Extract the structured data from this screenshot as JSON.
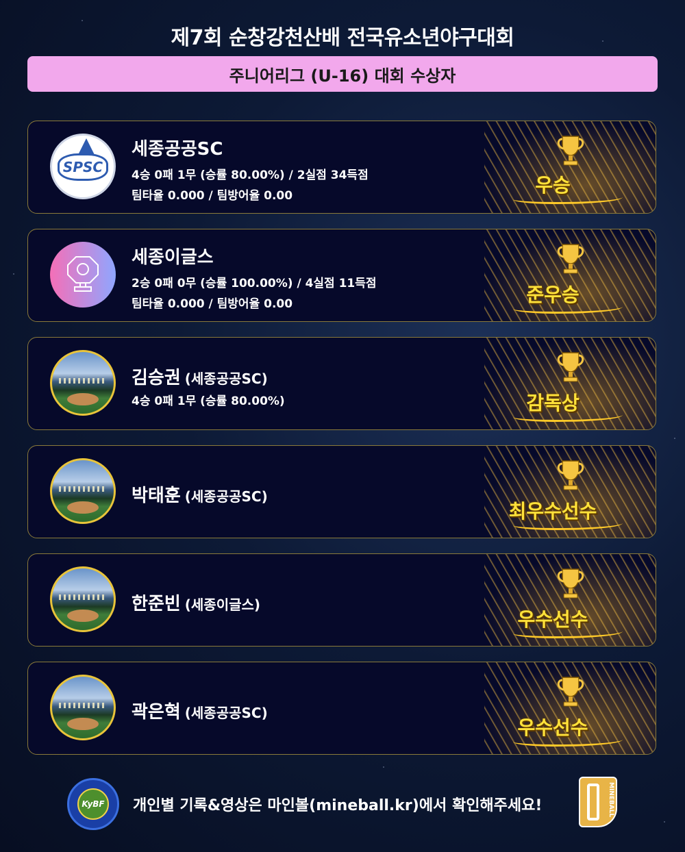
{
  "title": "제7회 순창강천산배 전국유소년야구대회",
  "subtitle": "주니어리그 (U-16) 대회 수상자",
  "awards": [
    {
      "name": "세종공공SC",
      "team": "",
      "info1": "4승 0패 1무 (승률 80.00%) / 2실점 34득점",
      "info2": "팀타율 0.000 / 팀방어율 0.00",
      "award": "우승",
      "logo_text": "SPSC",
      "logo": "spsc-logo"
    },
    {
      "name": "세종이글스",
      "team": "",
      "info1": "2승 0패 0무 (승률 100.00%) / 4실점 11득점",
      "info2": "팀타율 0.000 / 팀방어율 0.00",
      "award": "준우승",
      "logo": "trophy-placeholder-logo"
    },
    {
      "name": "김승권",
      "team": "(세종공공SC)",
      "info1": "4승 0패 1무 (승률 80.00%)",
      "award": "감독상",
      "logo": "stadium-avatar"
    },
    {
      "name": "박태훈",
      "team": "(세종공공SC)",
      "award": "최우수선수",
      "logo": "stadium-avatar"
    },
    {
      "name": "한준빈",
      "team": "(세종이글스)",
      "award": "우수선수",
      "logo": "stadium-avatar"
    },
    {
      "name": "곽은혁",
      "team": "(세종공공SC)",
      "award": "우수선수",
      "logo": "stadium-avatar"
    }
  ],
  "footer": {
    "text": "개인별 기록&영상은 마인볼(mineball.kr)에서 확인해주세요!",
    "kybf_logo_text": "KyBF",
    "mineball_logo_text": "MINEBALL"
  },
  "colors": {
    "subtitle_bg": "#f2a8ec",
    "award_gold": "#ffe23a",
    "card_border": "#8a7a3a",
    "background": "#0d1a36"
  }
}
